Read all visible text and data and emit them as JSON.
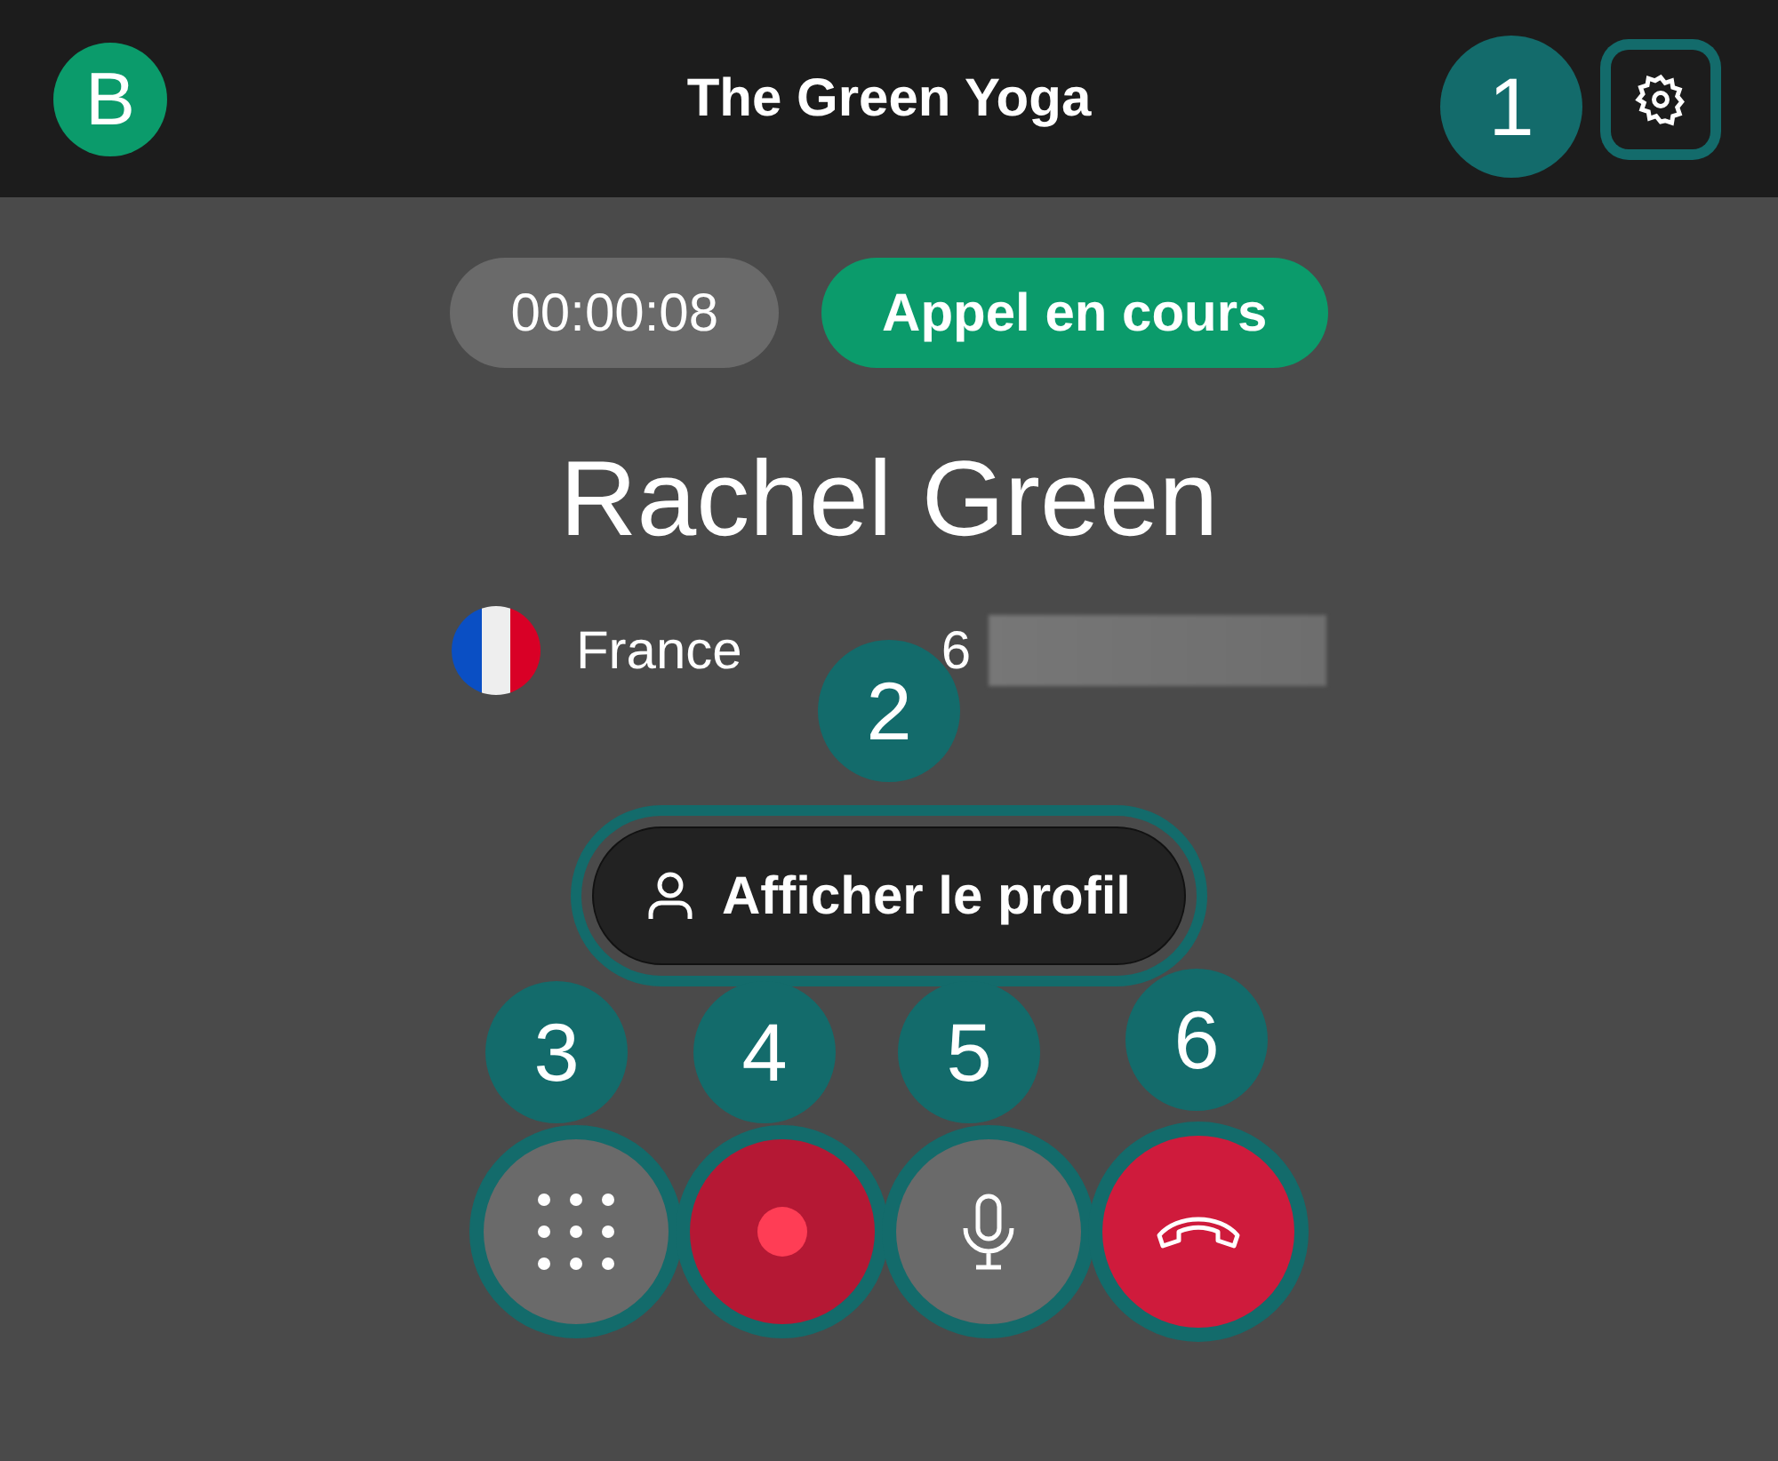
{
  "header": {
    "logo": "B",
    "title": "The Green Yoga"
  },
  "call": {
    "timer": "00:00:08",
    "status": "Appel en cours",
    "contact_name": "Rachel Green",
    "country": "France",
    "phone": "6"
  },
  "profile_button": {
    "label": "Afficher le profil"
  },
  "controls": [
    {
      "kind": "keypad"
    },
    {
      "kind": "record"
    },
    {
      "kind": "mic"
    },
    {
      "kind": "hangup"
    }
  ],
  "callouts": [
    "1",
    "2",
    "3",
    "4",
    "5",
    "6"
  ]
}
